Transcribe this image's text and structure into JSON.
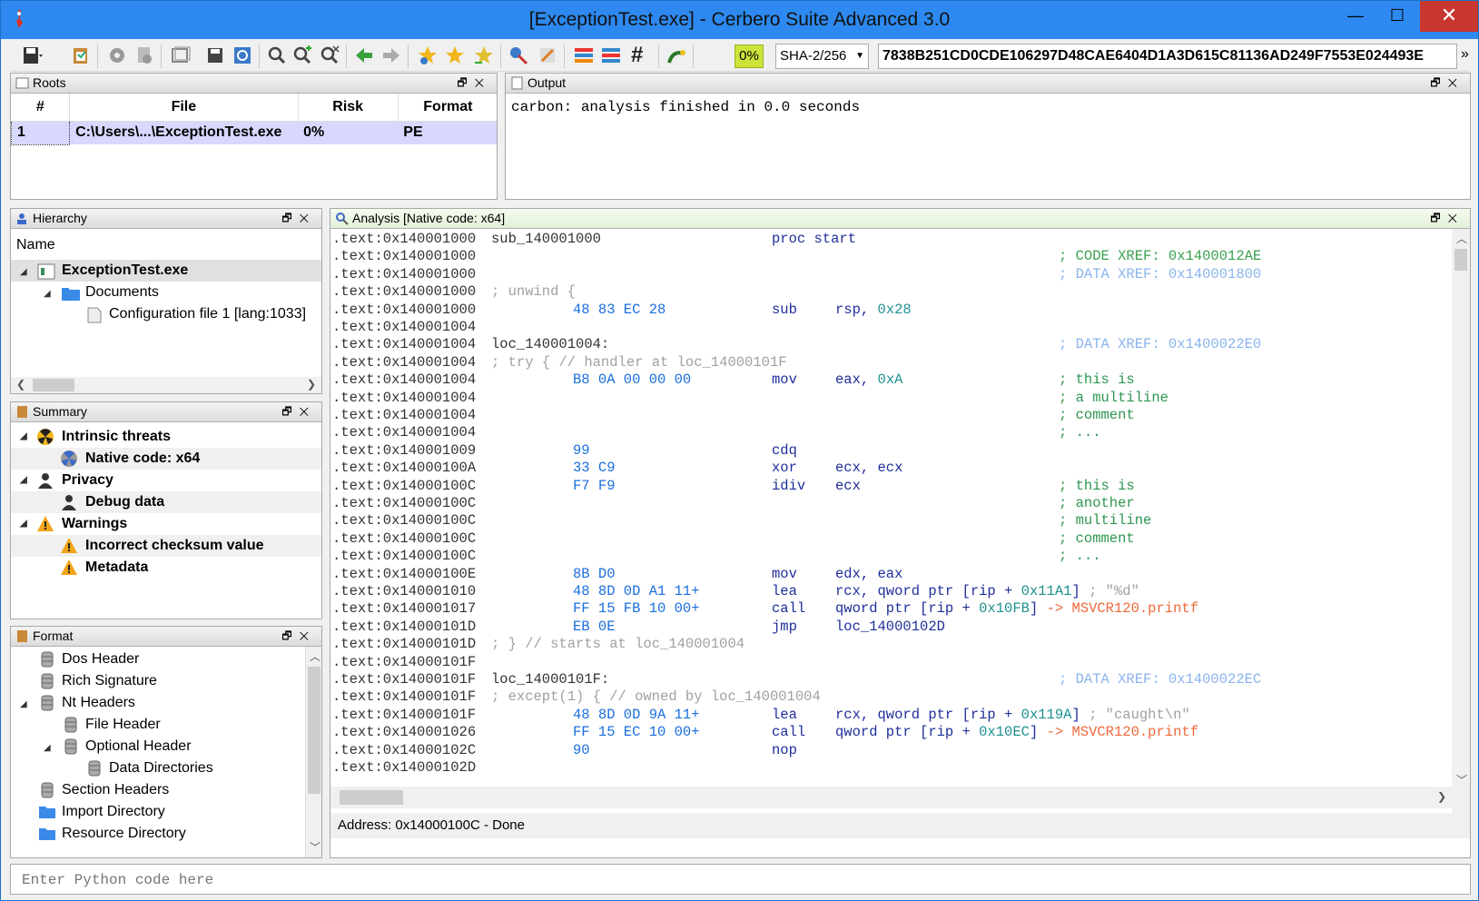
{
  "window": {
    "title": "[ExceptionTest.exe] - Cerbero Suite Advanced 3.0",
    "min": "—",
    "max": "☐",
    "close": "✕"
  },
  "toolbar": {
    "percent": "0%",
    "hash_algo": "SHA-2/256",
    "hash_value": "7838B251CD0CDE106297D48CAE6404D1A3D615C81136AD249F7553E024493E"
  },
  "roots": {
    "title": "Roots",
    "columns": [
      "#",
      "File",
      "Risk",
      "Format"
    ],
    "rows": [
      {
        "num": "1",
        "file": "C:\\Users\\...\\ExceptionTest.exe",
        "risk": "0%",
        "format": "PE"
      }
    ]
  },
  "output": {
    "title": "Output",
    "text": "carbon: analysis finished in 0.0 seconds"
  },
  "hierarchy": {
    "title": "Hierarchy",
    "header": "Name",
    "items": [
      "ExceptionTest.exe",
      "Documents",
      "Configuration file 1 [lang:1033]"
    ]
  },
  "summary": {
    "title": "Summary",
    "items": [
      "Intrinsic threats",
      "Native code: x64",
      "Privacy",
      "Debug data",
      "Warnings",
      "Incorrect checksum value",
      "Metadata"
    ]
  },
  "format": {
    "title": "Format",
    "items": [
      "Dos Header",
      "Rich Signature",
      "Nt Headers",
      "File Header",
      "Optional Header",
      "Data Directories",
      "Section Headers",
      "Import Directory",
      "Resource Directory"
    ]
  },
  "analysis": {
    "title": "Analysis [Native code: x64]",
    "status": "Address: 0x14000100C - Done",
    "lines": [
      {
        "addr": ".text:0x140001000",
        "label": "sub_140001000",
        "mn": "proc start"
      },
      {
        "addr": ".text:0x140001000",
        "xref": "; CODE XREF: 0x1400012AE"
      },
      {
        "addr": ".text:0x140001000",
        "dxref": "; DATA XREF: 0x140001800"
      },
      {
        "addr": ".text:0x140001000",
        "gray": "; unwind {"
      },
      {
        "addr": ".text:0x140001000",
        "bytes": "48 83 EC 28",
        "mn": "sub",
        "op": "rsp, ",
        "num": "0x28"
      },
      {
        "addr": ".text:0x140001004"
      },
      {
        "addr": ".text:0x140001004",
        "label": "loc_140001004:",
        "dxref": "; DATA XREF: 0x1400022E0"
      },
      {
        "addr": ".text:0x140001004",
        "gray": "; try { // handler at loc_14000101F"
      },
      {
        "addr": ".text:0x140001004",
        "bytes": "B8 0A 00 00 00",
        "mn": "mov",
        "op": "eax, ",
        "num": "0xA",
        "cm": "; this is"
      },
      {
        "addr": ".text:0x140001004",
        "cm": "; a multiline"
      },
      {
        "addr": ".text:0x140001004",
        "cm": "; comment"
      },
      {
        "addr": ".text:0x140001004",
        "cm": "; ..."
      },
      {
        "addr": ".text:0x140001009",
        "bytes": "99",
        "mn": "cdq"
      },
      {
        "addr": ".text:0x14000100A",
        "bytes": "33 C9",
        "mn": "xor",
        "op": "ecx, ecx"
      },
      {
        "addr": ".text:0x14000100C",
        "bytes": "F7 F9",
        "mn": "idiv",
        "op": "ecx",
        "cm": "; this is"
      },
      {
        "addr": ".text:0x14000100C",
        "cm": "; another"
      },
      {
        "addr": ".text:0x14000100C",
        "cm": "; multiline"
      },
      {
        "addr": ".text:0x14000100C",
        "cm": "; comment"
      },
      {
        "addr": ".text:0x14000100C",
        "cm": "; ..."
      },
      {
        "addr": ".text:0x14000100E",
        "bytes": "8B D0",
        "mn": "mov",
        "op": "edx, eax"
      },
      {
        "addr": ".text:0x140001010",
        "bytes": "48 8D 0D A1 11+",
        "mn": "lea",
        "op": "rcx, qword ptr [rip + ",
        "num": "0x11A1",
        "tail": "]",
        "str": " ; \"%d\""
      },
      {
        "addr": ".text:0x140001017",
        "bytes": "FF 15 FB 10 00+",
        "mn": "call",
        "op": "qword ptr [rip + ",
        "num": "0x10FB",
        "tail": "]",
        "api": " -> MSVCR120.printf"
      },
      {
        "addr": ".text:0x14000101D",
        "bytes": "EB 0E",
        "mn": "jmp",
        "op": "loc_14000102D"
      },
      {
        "addr": ".text:0x14000101D",
        "gray": "; } // starts at loc_140001004"
      },
      {
        "addr": ".text:0x14000101F"
      },
      {
        "addr": ".text:0x14000101F",
        "label": "loc_14000101F:",
        "dxref": "; DATA XREF: 0x1400022EC"
      },
      {
        "addr": ".text:0x14000101F",
        "gray": "; except(1) { // owned by loc_140001004"
      },
      {
        "addr": ".text:0x14000101F",
        "bytes": "48 8D 0D 9A 11+",
        "mn": "lea",
        "op": "rcx, qword ptr [rip + ",
        "num": "0x119A",
        "tail": "]",
        "str": " ; \"caught\\n\""
      },
      {
        "addr": ".text:0x140001026",
        "bytes": "FF 15 EC 10 00+",
        "mn": "call",
        "op": "qword ptr [rip + ",
        "num": "0x10EC",
        "tail": "]",
        "api": " -> MSVCR120.printf"
      },
      {
        "addr": ".text:0x14000102C",
        "bytes": "90",
        "mn": "nop"
      },
      {
        "addr": ".text:0x14000102D"
      }
    ]
  },
  "python": {
    "placeholder": "Enter Python code here"
  }
}
